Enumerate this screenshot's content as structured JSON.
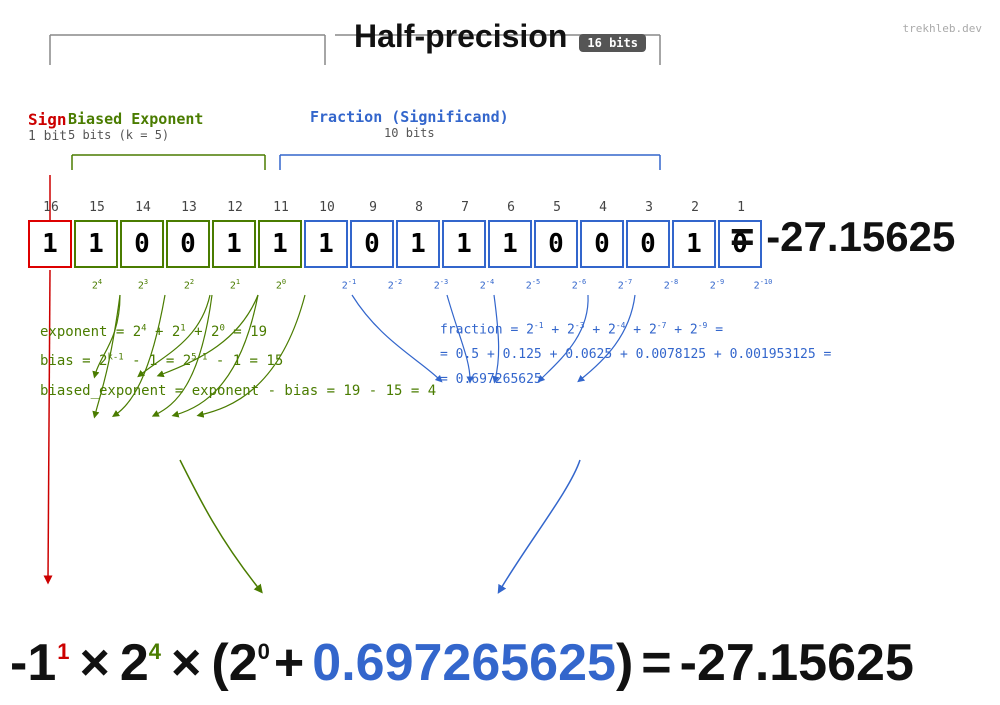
{
  "title": "Half-precision",
  "badge": "16 bits",
  "site": "trekhleb.dev",
  "result": "= -27.15625",
  "labels": {
    "sign": "Sign",
    "sign_bits": "1 bit",
    "exponent": "Biased Exponent",
    "exponent_bits": "5 bits (k = 5)",
    "fraction": "Fraction (Significand)",
    "fraction_bits": "10 bits"
  },
  "bit_positions": [
    "16",
    "15",
    "14",
    "13",
    "12",
    "11",
    "10",
    "9",
    "8",
    "7",
    "6",
    "5",
    "4",
    "3",
    "2",
    "1"
  ],
  "bits": [
    {
      "value": "1",
      "type": "sign"
    },
    {
      "value": "1",
      "type": "exp"
    },
    {
      "value": "0",
      "type": "exp"
    },
    {
      "value": "0",
      "type": "exp"
    },
    {
      "value": "1",
      "type": "exp"
    },
    {
      "value": "1",
      "type": "exp"
    },
    {
      "value": "1",
      "type": "frac"
    },
    {
      "value": "0",
      "type": "frac"
    },
    {
      "value": "1",
      "type": "frac"
    },
    {
      "value": "1",
      "type": "frac"
    },
    {
      "value": "1",
      "type": "frac"
    },
    {
      "value": "0",
      "type": "frac"
    },
    {
      "value": "0",
      "type": "frac"
    },
    {
      "value": "0",
      "type": "frac"
    },
    {
      "value": "1",
      "type": "frac"
    },
    {
      "value": "0",
      "type": "frac"
    }
  ],
  "exp_powers": [
    "2⁴",
    "2³",
    "2²",
    "2¹",
    "2⁰"
  ],
  "frac_powers": [
    "2⁻¹",
    "2⁻²",
    "2⁻³",
    "2⁻⁴",
    "2⁻⁵",
    "2⁻⁶",
    "2⁻⁷",
    "2⁻⁸",
    "2⁻⁹",
    "2⁻¹⁰"
  ],
  "calc": {
    "exponent_line": "exponent = 2⁴ + 2¹ + 2⁰ = 19",
    "bias_line": "bias = 2^(k-1) - 1 = 2^(5-1) - 1 = 15",
    "biased_line": "biased_exponent = exponent - bias = 19 - 15 = 4",
    "fraction_line1": "fraction = 2⁻¹ + 2⁻³ + 2⁻⁴ + 2⁻⁷ + 2⁻⁹ =",
    "fraction_line2": "= 0.5 + 0.125 + 0.0625 + 0.0078125 + 0.001953125 =",
    "fraction_line3": "= 0.697265625"
  },
  "formula": {
    "neg_one": "-1",
    "neg_one_sup": "1",
    "times1": "×",
    "two": "2",
    "two_sup": "4",
    "times2": "×",
    "paren_open": "(2",
    "paren_two_sup": "0",
    "plus": "+",
    "fraction_val": "0.697265625",
    "paren_close": ")",
    "equals": "=",
    "result_val": "-27.15625"
  }
}
